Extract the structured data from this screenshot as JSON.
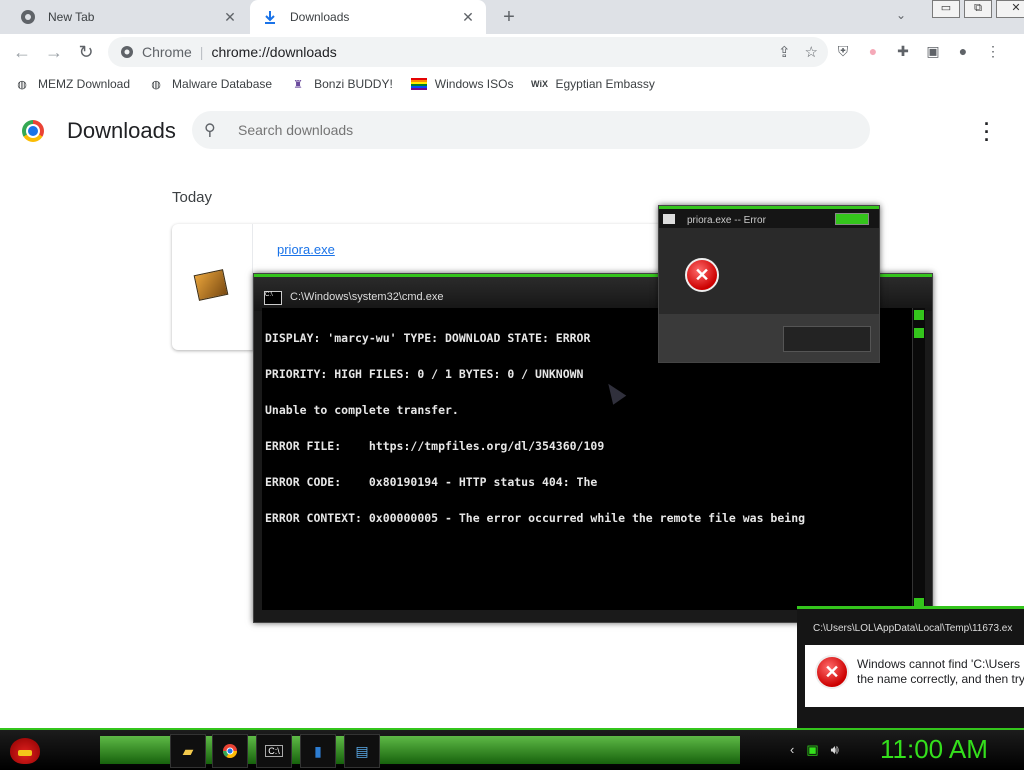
{
  "tabs": [
    {
      "label": "New Tab",
      "icon": "chrome-icon",
      "active": false
    },
    {
      "label": "Downloads",
      "icon": "download-icon",
      "active": true
    }
  ],
  "window_buttons": {
    "minimize": "▭",
    "restore": "⧉",
    "close": "✕"
  },
  "address_bar": {
    "site_label": "Chrome",
    "url": "chrome://downloads"
  },
  "bookmarks": [
    {
      "label": "MEMZ Download",
      "icon": "globe-icon"
    },
    {
      "label": "Malware Database",
      "icon": "globe-icon"
    },
    {
      "label": "Bonzi BUDDY!",
      "icon": "bonzi-icon"
    },
    {
      "label": "Windows ISOs",
      "icon": "rainbow-flag-icon"
    },
    {
      "label": "Egyptian Embassy",
      "icon": "wix-icon"
    }
  ],
  "downloads_page": {
    "title": "Downloads",
    "search_placeholder": "Search downloads",
    "section_label": "Today",
    "item": {
      "filename": "priora.exe"
    }
  },
  "cmd_window": {
    "title": "C:\\Windows\\system32\\cmd.exe",
    "lines": [
      "DISPLAY: 'marcy-wu' TYPE: DOWNLOAD STATE: ERROR",
      "PRIORITY: HIGH FILES: 0 / 1 BYTES: 0 / UNKNOWN",
      "Unable to complete transfer.",
      "ERROR FILE:    https://tmpfiles.org/dl/354360/109",
      "ERROR CODE:    0x80190194 - HTTP status 404: The",
      "ERROR CONTEXT: 0x00000005 - The error occurred while the remote file was being"
    ]
  },
  "error_dialog": {
    "title": "priora.exe -- Error"
  },
  "error_dialog_2": {
    "title": "C:\\Users\\LOL\\AppData\\Local\\Temp\\11673.ex",
    "message_line1": "Windows cannot find 'C:\\Users",
    "message_line2": "the name correctly, and then try"
  },
  "taskbar": {
    "clock": "11:00 AM",
    "apps": [
      "file-explorer-icon",
      "chrome-icon",
      "cmd-icon",
      "phone-icon",
      "window-icon"
    ]
  },
  "colors": {
    "accent_green": "#34c51c",
    "link_blue": "#1a73e8"
  }
}
